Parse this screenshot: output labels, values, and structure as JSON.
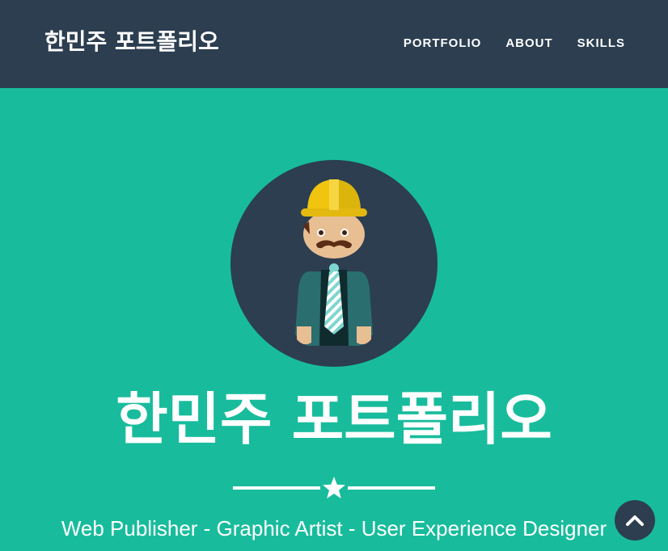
{
  "navbar": {
    "brand": "한민주 포트폴리오",
    "links": [
      "PORTFOLIO",
      "ABOUT",
      "SKILLS"
    ]
  },
  "hero": {
    "title": "한민주 포트폴리오",
    "subtitle": "Web Publisher - Graphic Artist - User Experience Designer",
    "divider_icon": "star-icon"
  },
  "scroll_top": {
    "icon": "chevron-up-icon"
  },
  "colors": {
    "navbar_bg": "#2c3e50",
    "hero_bg": "#18bc9c",
    "text": "#ffffff",
    "avatar_circle": "#2c3e50",
    "helmet": "#f1c40f",
    "jacket": "#2a6e70"
  }
}
